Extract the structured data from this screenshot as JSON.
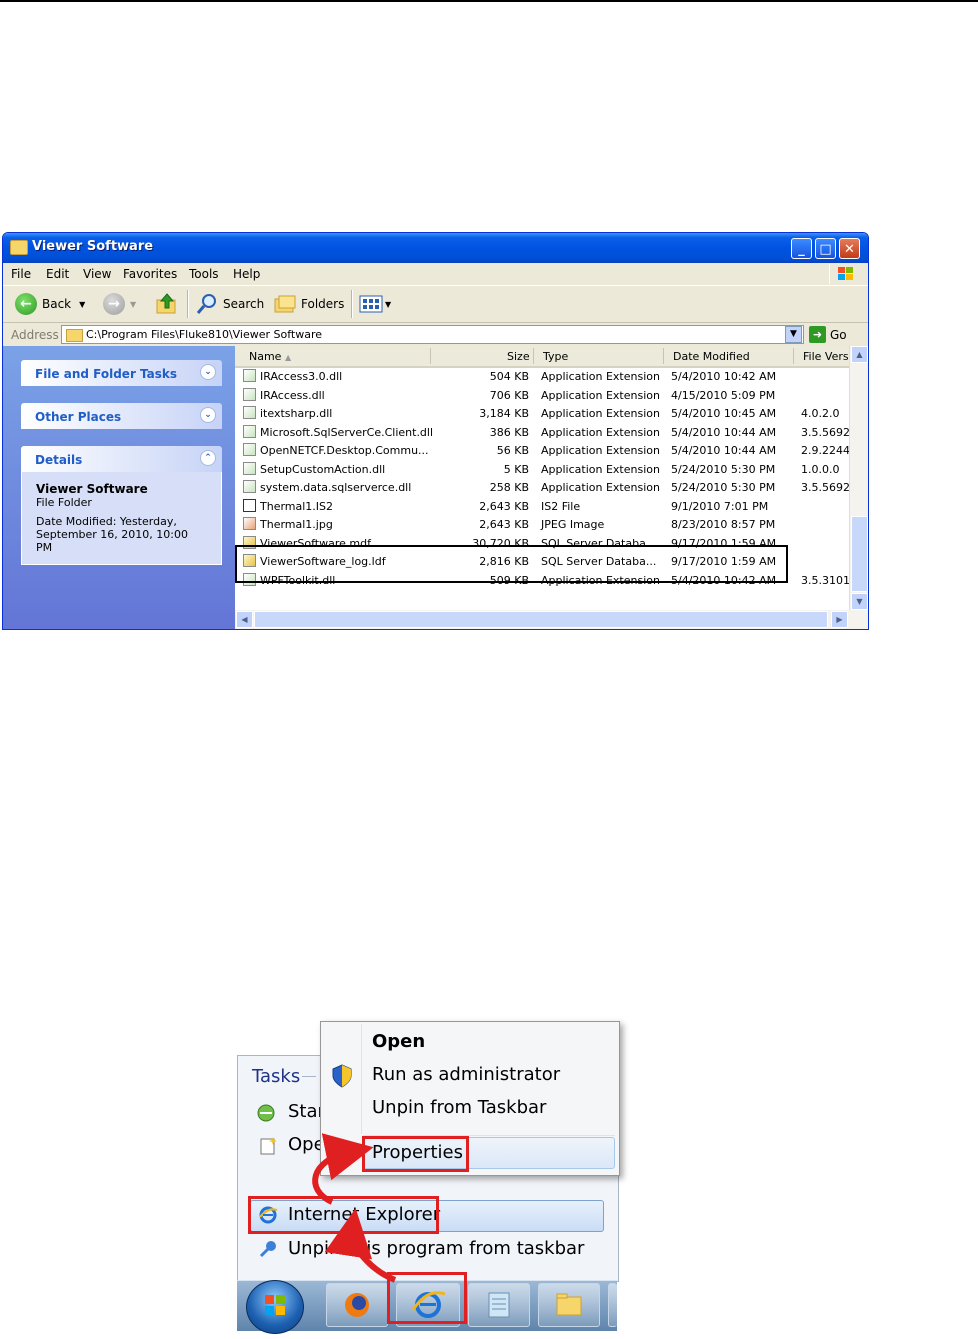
{
  "explorer": {
    "title": "Viewer Software",
    "menu": [
      "File",
      "Edit",
      "View",
      "Favorites",
      "Tools",
      "Help"
    ],
    "toolbar": {
      "back": "Back",
      "search": "Search",
      "folders": "Folders"
    },
    "address": {
      "label": "Address",
      "path": "C:\\Program Files\\Fluke810\\Viewer Software",
      "go": "Go"
    },
    "tasks": {
      "file_folder": "File and Folder Tasks",
      "other_places": "Other Places",
      "details": "Details",
      "details_name": "Viewer Software",
      "details_type": "File Folder",
      "details_modified": "Date Modified: Yesterday, September 16, 2010, 10:00 PM"
    },
    "columns": [
      "Name",
      "Size",
      "Type",
      "Date Modified",
      "File Vers"
    ],
    "files": [
      {
        "name": "IRAccess3.0.dll",
        "size": "504 KB",
        "type": "Application Extension",
        "date": "5/4/2010 10:42 AM",
        "version": ""
      },
      {
        "name": "IRAccess.dll",
        "size": "706 KB",
        "type": "Application Extension",
        "date": "4/15/2010 5:09 PM",
        "version": ""
      },
      {
        "name": "itextsharp.dll",
        "size": "3,184 KB",
        "type": "Application Extension",
        "date": "5/4/2010 10:45 AM",
        "version": "4.0.2.0"
      },
      {
        "name": "Microsoft.SqlServerCe.Client.dll",
        "size": "386 KB",
        "type": "Application Extension",
        "date": "5/4/2010 10:44 AM",
        "version": "3.5.5692"
      },
      {
        "name": "OpenNETCF.Desktop.Commu...",
        "size": "56 KB",
        "type": "Application Extension",
        "date": "5/4/2010 10:44 AM",
        "version": "2.9.2244"
      },
      {
        "name": "SetupCustomAction.dll",
        "size": "5 KB",
        "type": "Application Extension",
        "date": "5/24/2010 5:30 PM",
        "version": "1.0.0.0"
      },
      {
        "name": "system.data.sqlserverce.dll",
        "size": "258 KB",
        "type": "Application Extension",
        "date": "5/24/2010 5:30 PM",
        "version": "3.5.5692"
      },
      {
        "name": "Thermal1.IS2",
        "size": "2,643 KB",
        "type": "IS2 File",
        "date": "9/1/2010 7:01 PM",
        "version": ""
      },
      {
        "name": "Thermal1.jpg",
        "size": "2,643 KB",
        "type": "JPEG Image",
        "date": "8/23/2010 8:57 PM",
        "version": ""
      },
      {
        "name": "ViewerSoftware.mdf",
        "size": "30,720 KB",
        "type": "SQL Server Databa...",
        "date": "9/17/2010 1:59 AM",
        "version": ""
      },
      {
        "name": "ViewerSoftware_log.ldf",
        "size": "2,816 KB",
        "type": "SQL Server Databa...",
        "date": "9/17/2010 1:59 AM",
        "version": ""
      },
      {
        "name": "WPFToolkit.dll",
        "size": "509 KB",
        "type": "Application Extension",
        "date": "5/4/2010 10:42 AM",
        "version": "3.5.3101"
      }
    ]
  },
  "jumplist": {
    "tasks_label": "Tasks",
    "start_partial": "Star",
    "open_partial": "Ope",
    "ctx_open": "Open",
    "ctx_run_admin": "Run as administrator",
    "ctx_unpin_taskbar": "Unpin from Taskbar",
    "ctx_properties": "Properties",
    "ie_label": "Internet Explorer",
    "unpin_left": "Unpin",
    "unpin_right": "is program from taskbar"
  },
  "colors": {
    "xp_title": "#0053e1",
    "xp_taskpane": "#6f8de0",
    "highlight_red": "#e02020",
    "ie_blue": "#1e73d8"
  }
}
